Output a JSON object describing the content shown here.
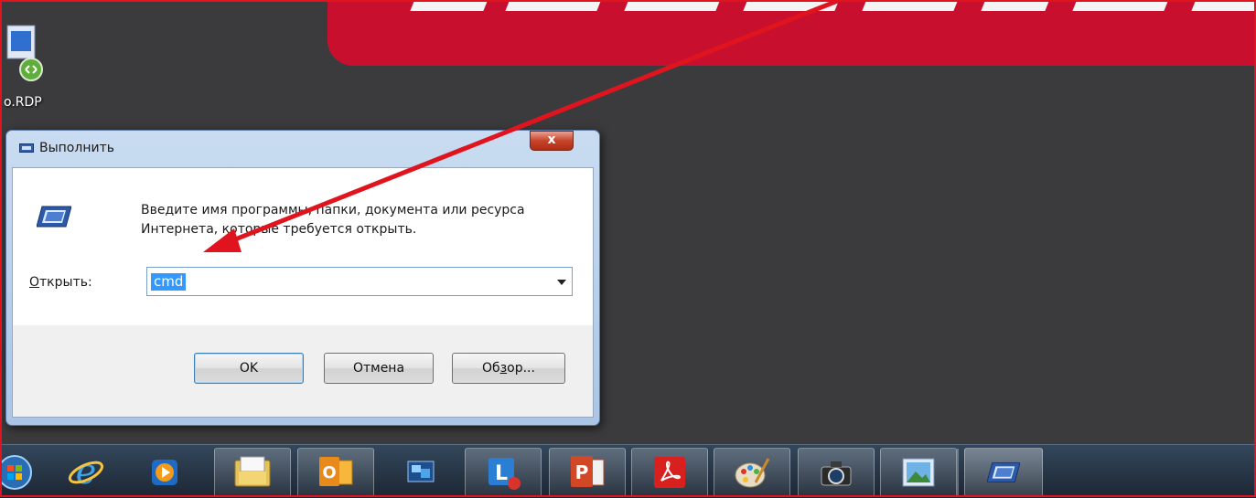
{
  "desktop": {
    "rdp_icon_label": "o.RDP"
  },
  "dialog": {
    "title": "Выполнить",
    "close_glyph": "x",
    "description": "Введите имя программы, папки, документа или ресурса Интернета, которые требуется открыть.",
    "open_label_underlined": "О",
    "open_label_rest": "ткрыть:",
    "open_value": "cmd",
    "buttons": {
      "ok": "OK",
      "cancel": "Отмена",
      "browse_prefix": "Об",
      "browse_underlined": "з",
      "browse_suffix": "ор..."
    }
  },
  "taskbar": {
    "items": [
      {
        "name": "start-orb-icon"
      },
      {
        "name": "internet-explorer-icon"
      },
      {
        "name": "media-player-icon"
      },
      {
        "name": "file-explorer-icon"
      },
      {
        "name": "outlook-icon"
      },
      {
        "name": "remote-desktop-icon"
      },
      {
        "name": "lync-icon"
      },
      {
        "name": "powerpoint-icon"
      },
      {
        "name": "acrobat-icon"
      },
      {
        "name": "paint-icon"
      },
      {
        "name": "camera-icon"
      },
      {
        "name": "photo-viewer-icon"
      },
      {
        "name": "run-icon"
      }
    ]
  },
  "colors": {
    "annotation_arrow": "#e0141e",
    "selection": "#3399ff",
    "banner": "#c8102e"
  }
}
